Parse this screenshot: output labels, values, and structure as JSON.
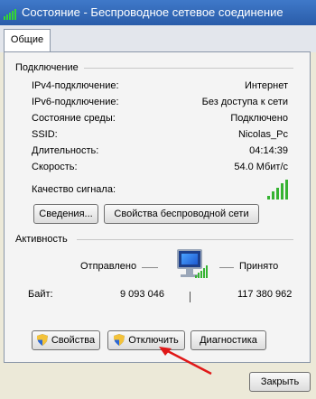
{
  "window": {
    "title": "Состояние - Беспроводное сетевое соединение"
  },
  "tabs": [
    {
      "label": "Общие"
    }
  ],
  "connection": {
    "group_title": "Подключение",
    "rows": [
      {
        "label": "IPv4-подключение:",
        "value": "Интернет"
      },
      {
        "label": "IPv6-подключение:",
        "value": "Без доступа к сети"
      },
      {
        "label": "Состояние среды:",
        "value": "Подключено"
      },
      {
        "label": "SSID:",
        "value": "Nicolas_Pc"
      },
      {
        "label": "Длительность:",
        "value": "04:14:39"
      },
      {
        "label": "Скорость:",
        "value": "54.0 Мбит/с"
      }
    ],
    "signal_label": "Качество сигнала:",
    "signal_bars": 5,
    "signal_bars_max": 5,
    "details_button": "Сведения...",
    "wireless_props_button": "Свойства беспроводной сети"
  },
  "activity": {
    "group_title": "Активность",
    "sent_label": "Отправлено",
    "received_label": "Принято",
    "bytes_label": "Байт:",
    "sent_value": "9 093 046",
    "received_value": "117 380 962"
  },
  "buttons": {
    "properties": "Свойства",
    "disconnect": "Отключить",
    "diagnostics": "Диагностика",
    "close": "Закрыть"
  },
  "colors": {
    "signal_green": "#36b332",
    "arrow_red": "#e01818"
  }
}
